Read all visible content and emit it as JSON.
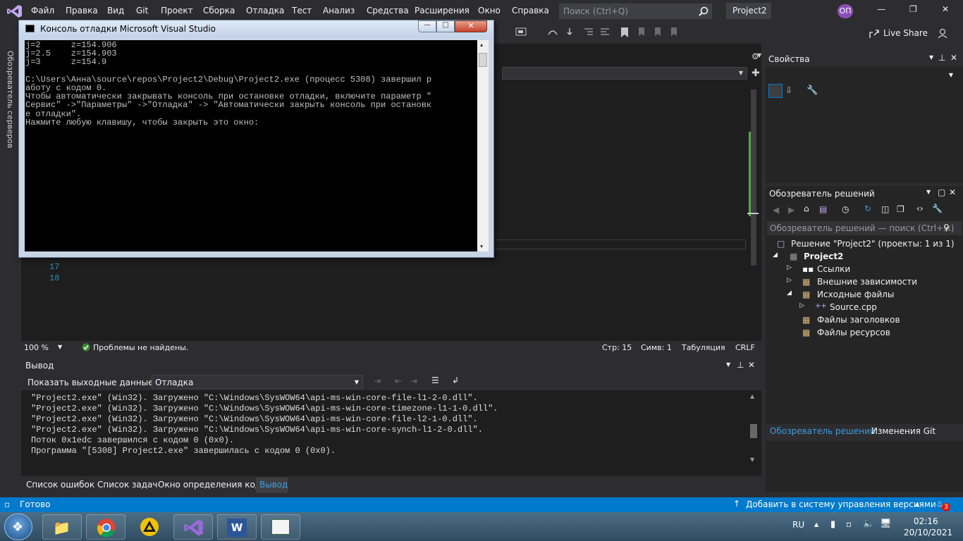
{
  "menu": {
    "items": [
      "Файл",
      "Правка",
      "Вид",
      "Git",
      "Проект",
      "Сборка",
      "Отладка",
      "Тест",
      "Анализ",
      "Средства",
      "Расширения",
      "Окно",
      "Справка"
    ],
    "search_placeholder": "Поиск (Ctrl+Q)",
    "solution_name": "Project2",
    "user_initials": "ОП"
  },
  "toolbar": {
    "live_share": "Live Share"
  },
  "side": {
    "server_explorer": "Обозреватель серверов"
  },
  "console": {
    "title": "Консоль отладки Microsoft Visual Studio",
    "lines": [
      "j=2      z=154.906",
      "j=2.5    z=154.903",
      "j=3      z=154.9",
      "",
      "C:\\Users\\Анна\\source\\repos\\Project2\\Debug\\Project2.exe (процесс 5308) завершил р",
      "аботу с кодом 0.",
      "Чтобы автоматически закрывать консоль при остановке отладки, включите параметр \"",
      "Сервис\" ->\"Параметры\" ->\"Отладка\" -> \"Автоматически закрыть консоль при остановк",
      "е отладки\".",
      "Нажмите любую клавишу, чтобы закрыть это окно:"
    ]
  },
  "editor": {
    "line_numbers": [
      "17",
      "18"
    ],
    "zoom": "100 %",
    "status": "Проблемы не найдены.",
    "line": "Стр: 15",
    "col": "Симв: 1",
    "tabs": "Табуляция",
    "eol": "CRLF"
  },
  "properties": {
    "title": "Свойства"
  },
  "solution_explorer": {
    "title": "Обозреватель решений",
    "search_placeholder": "Обозреватель решений — поиск (Ctrl+ж)",
    "solution": "Решение \"Project2\" (проекты: 1 из 1)",
    "project": "Project2",
    "items": [
      "Ссылки",
      "Внешние зависимости",
      "Исходные файлы",
      "Source.cpp",
      "Файлы заголовков",
      "Файлы ресурсов"
    ],
    "tab_active": "Обозреватель решений",
    "tab_other": "Изменения Git"
  },
  "output": {
    "title": "Вывод",
    "show_from_label": "Показать выходные данные из:",
    "source": "Отладка",
    "lines": [
      "\"Project2.exe\" (Win32). Загружено \"C:\\Windows\\SysWOW64\\api-ms-win-core-file-l1-2-0.dll\".",
      "\"Project2.exe\" (Win32). Загружено \"C:\\Windows\\SysWOW64\\api-ms-win-core-timezone-l1-1-0.dll\".",
      "\"Project2.exe\" (Win32). Загружено \"C:\\Windows\\SysWOW64\\api-ms-win-core-file-l2-1-0.dll\".",
      "\"Project2.exe\" (Win32). Загружено \"C:\\Windows\\SysWOW64\\api-ms-win-core-synch-l1-2-0.dll\".",
      "Поток 0x1edc завершился с кодом 0 (0x0).",
      "Программа \"[5308] Project2.exe\" завершилась с кодом 0 (0x0)."
    ]
  },
  "bottom_tabs": [
    "Список ошибок",
    "Список задач",
    "Окно определения кода",
    "Вывод"
  ],
  "statusbar": {
    "ready": "Готово",
    "source_control": "Добавить в систему управления версиями",
    "notifications": "3"
  },
  "taskbar": {
    "lang": "RU",
    "time": "02:16",
    "date": "20/10/2021"
  },
  "colors": {
    "accent": "#007acc",
    "bg": "#2d2d30",
    "editor": "#1e1e1e"
  }
}
